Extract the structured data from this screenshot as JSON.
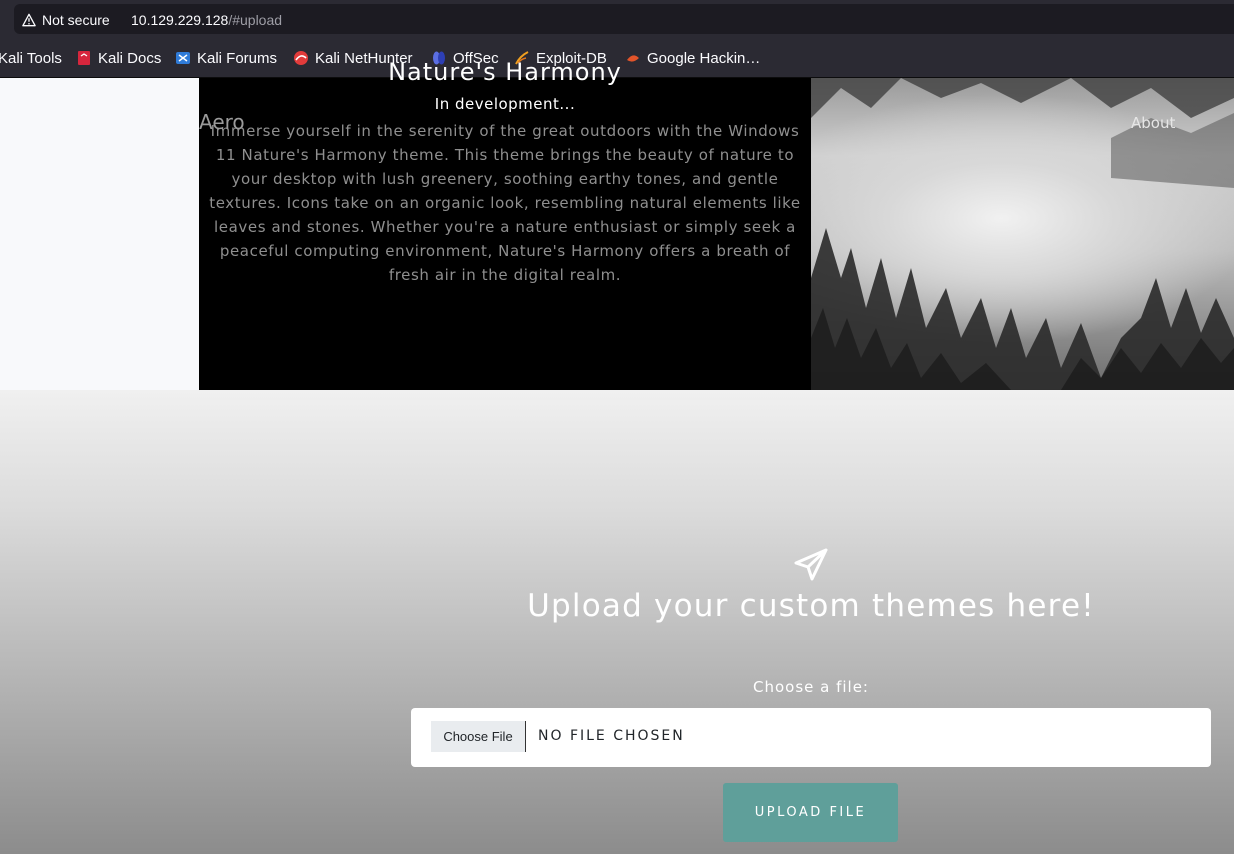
{
  "browser": {
    "security_label": "Not secure",
    "url_host": "10.129.229.128",
    "url_path": "/#upload",
    "bookmarks": [
      {
        "label": "Kali Tools",
        "icon": "kali-tools-icon"
      },
      {
        "label": "Kali Docs",
        "icon": "kali-docs-icon"
      },
      {
        "label": "Kali Forums",
        "icon": "kali-forums-icon"
      },
      {
        "label": "Kali NetHunter",
        "icon": "kali-nethunter-icon"
      },
      {
        "label": "OffSec",
        "icon": "offsec-icon"
      },
      {
        "label": "Exploit-DB",
        "icon": "exploit-db-icon"
      },
      {
        "label": "Google Hackin…",
        "icon": "google-hacking-icon"
      }
    ]
  },
  "nav": {
    "brand": "Aero",
    "about": "About"
  },
  "theme": {
    "title": "Nature's Harmony",
    "subtitle": "In development...",
    "description_lines": [
      "Immerse yourself in the serenity of the great outdoors with the Windows",
      "11 Nature's Harmony theme. This theme brings the beauty of nature to",
      "your desktop with lush greenery, soothing earthy tones, and gentle",
      "textures. Icons take on an organic look, resembling natural elements like",
      "leaves and stones. Whether you're a nature enthusiast or simply seek a",
      "peaceful computing environment, Nature's Harmony offers a breath of",
      "fresh air in the digital realm."
    ]
  },
  "upload": {
    "icon": "paper-plane-icon",
    "title": "Upload your custom themes here!",
    "choose_label": "Choose a file:",
    "choose_button": "Choose File",
    "no_file": "NO FILE CHOSEN",
    "submit": "UPLOAD FILE"
  },
  "colors": {
    "browser_chrome": "#2b2a33",
    "upload_button": "#5f9f9a",
    "hero_dark": "#000000"
  }
}
